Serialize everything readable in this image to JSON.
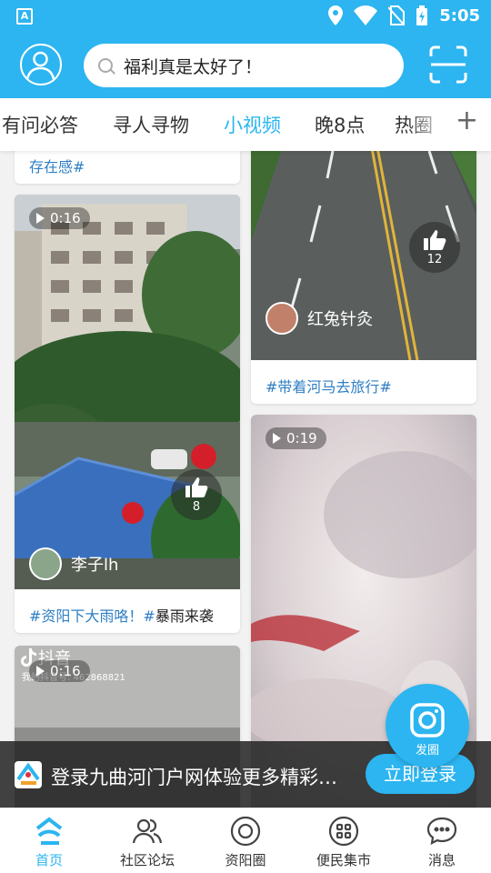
{
  "status_bar": {
    "time": "5:05",
    "app_icon_letter": "A"
  },
  "header": {
    "search_text": "福利真是太好了！"
  },
  "tabs": [
    {
      "label": "有问必答"
    },
    {
      "label": "寻人寻物"
    },
    {
      "label": "小视频",
      "active": true
    },
    {
      "label": "晚8点"
    },
    {
      "label": "热圈"
    }
  ],
  "tabs_more": "+",
  "feed": {
    "top_partial_tags": "存在感#",
    "cards": [
      {
        "duration": "0:16",
        "likes": "8",
        "author": "李子lh",
        "tags": [
          "#资阳下大雨咯！",
          "#暴雨来袭"
        ]
      },
      {
        "likes": "12",
        "author": "红兔针灸",
        "tags": [
          "#带着河马去旅行#"
        ]
      },
      {
        "duration": "0:19"
      },
      {
        "duration": "0:16",
        "watermark": "抖音",
        "watermark_id": "我的抖音号: 462868821"
      }
    ]
  },
  "fab": {
    "label": "发圈"
  },
  "login_banner": {
    "text": "登录九曲河门户网体验更多精彩…",
    "button": "立即登录"
  },
  "bottom_nav": [
    {
      "label": "首页",
      "active": true
    },
    {
      "label": "社区论坛"
    },
    {
      "label": "资阳圈"
    },
    {
      "label": "便民集市"
    },
    {
      "label": "消息"
    }
  ],
  "colors": {
    "brand": "#2cb5f0",
    "tag": "#2f7fc4"
  }
}
